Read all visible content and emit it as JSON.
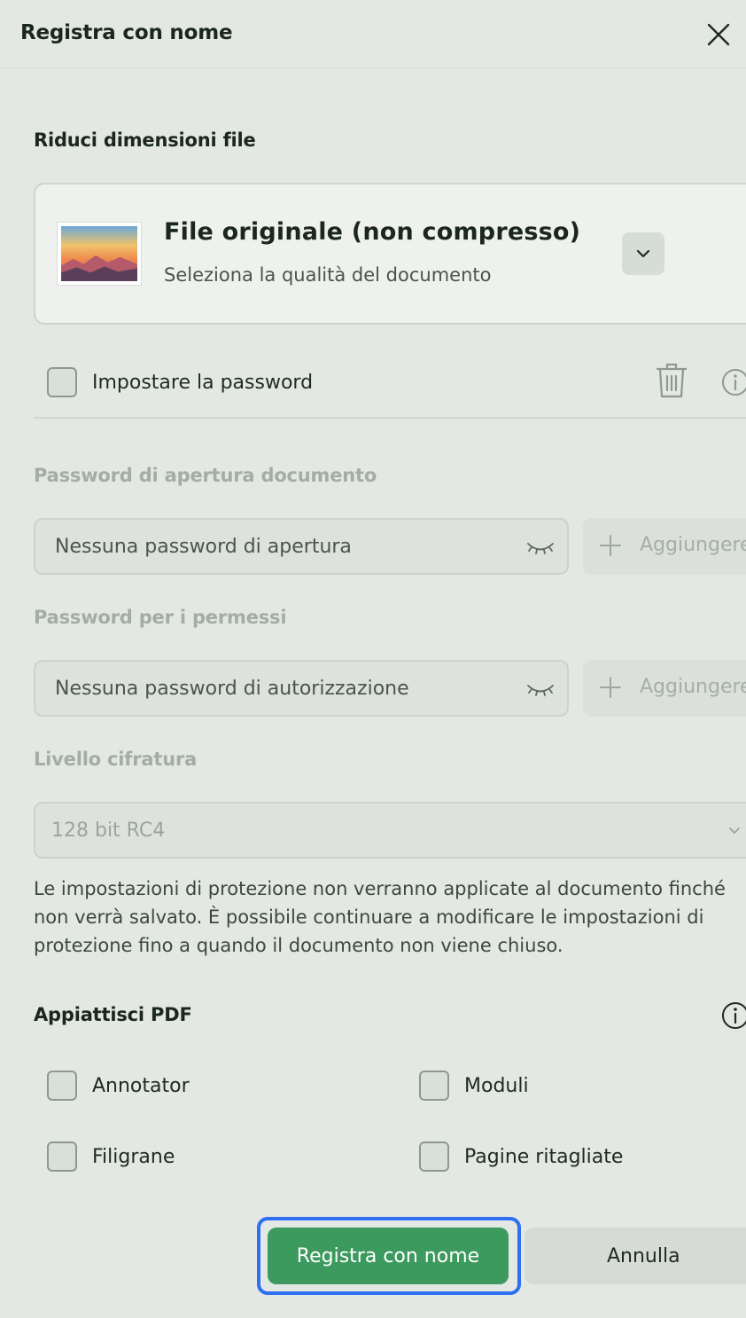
{
  "dialog": {
    "title": "Registra con nome",
    "close_icon": "close-icon"
  },
  "compress": {
    "section_title": "Riduci dimensioni file",
    "option_title": "File originale (non compresso)",
    "option_subtitle": "Seleziona la qualità del documento",
    "thumbnail_icon": "landscape-image-thumbnail",
    "dropdown_icon": "chevron-down-icon"
  },
  "password": {
    "set_password_label": "Impostare la password",
    "set_password_checked": false,
    "delete_icon": "trash-icon",
    "info_icon": "info-icon",
    "open_password_label": "Password di apertura documento",
    "open_password_placeholder": "Nessuna password di apertura",
    "permissions_label": "Password per i permessi",
    "permissions_placeholder": "Nessuna password di autorizzazione",
    "add_label": "Aggiungere",
    "encryption_label": "Livello cifratura",
    "encryption_value": "128 bit RC4",
    "note": "Le impostazioni di protezione non verranno applicate al documento finché non verrà salvato. È possibile continuare a modificare le impostazioni di protezione fino a quando il documento non viene chiuso."
  },
  "flatten": {
    "section_title": "Appiattisci PDF",
    "info_icon": "info-icon",
    "options": [
      {
        "label": "Annotator",
        "checked": false
      },
      {
        "label": "Moduli",
        "checked": false
      },
      {
        "label": "Filigrane",
        "checked": false
      },
      {
        "label": "Pagine ritagliate",
        "checked": false
      }
    ]
  },
  "footer": {
    "save_label": "Registra con nome",
    "cancel_label": "Annulla"
  },
  "colors": {
    "background": "#e3e8e4",
    "primary": "#3d9a5e",
    "focus": "#2f6ff2"
  }
}
